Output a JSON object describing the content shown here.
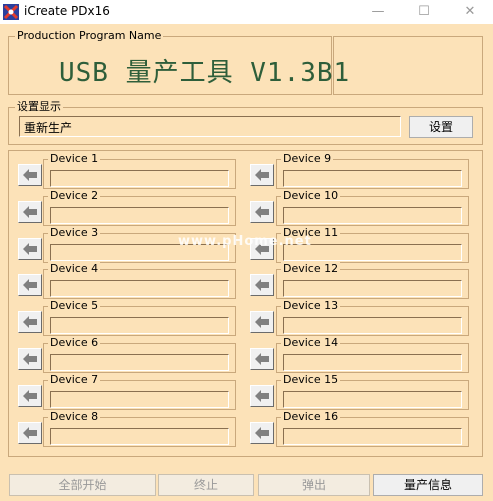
{
  "window": {
    "title": "iCreate PDx16",
    "minimize_glyph": "—",
    "maximize_glyph": "☐",
    "close_glyph": "✕"
  },
  "program": {
    "group_label": "Production Program Name",
    "title": "USB 量产工具 V1.3B1"
  },
  "settings": {
    "group_label": "设置显示",
    "value": "重新生产",
    "button_label": "设置"
  },
  "devices": {
    "left": [
      "Device 1",
      "Device 2",
      "Device 3",
      "Device 4",
      "Device 5",
      "Device 6",
      "Device 7",
      "Device 8"
    ],
    "right": [
      "Device 9",
      "Device 10",
      "Device 11",
      "Device 12",
      "Device 13",
      "Device 14",
      "Device 15",
      "Device 16"
    ],
    "arrow_icon": "left-arrow-icon"
  },
  "bottom_buttons": {
    "start_all": "全部开始",
    "stop": "终止",
    "eject": "弹出",
    "info": "量产信息"
  },
  "watermark": "www.pHome.net",
  "colors": {
    "background": "#fce2b8",
    "title_text": "#2e5e3a"
  }
}
